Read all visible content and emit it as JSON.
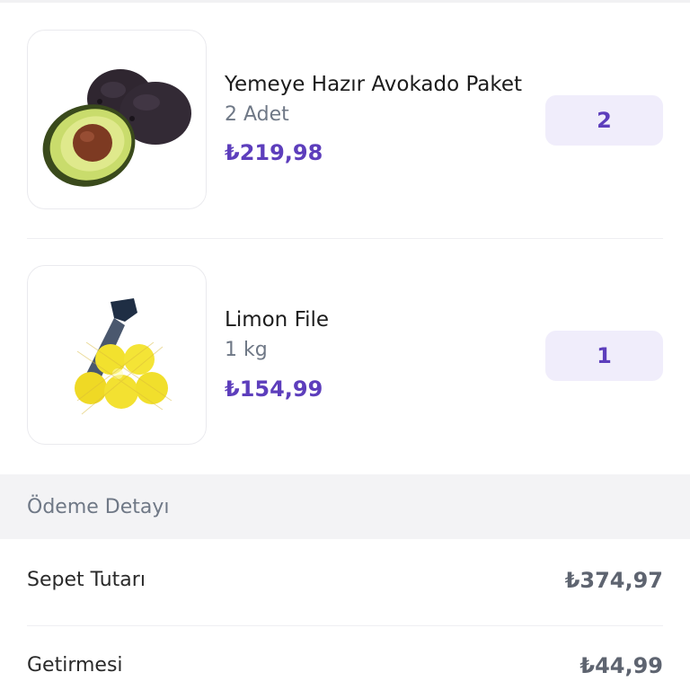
{
  "cart": {
    "items": [
      {
        "name": "Yemeye Hazır Avokado Paket",
        "unit": "2 Adet",
        "price": "₺219,98",
        "quantity": "2",
        "image_icon": "avocado-image"
      },
      {
        "name": "Limon File",
        "unit": "1 kg",
        "price": "₺154,99",
        "quantity": "1",
        "image_icon": "lemon-net-image"
      }
    ]
  },
  "payment": {
    "title": "Ödeme Detayı",
    "rows": [
      {
        "label": "Sepet Tutarı",
        "value": "₺374,97"
      },
      {
        "label": "Getirmesi",
        "value": "₺44,99"
      }
    ]
  },
  "colors": {
    "accent": "#5d3ebc",
    "badge_bg": "#f0edfb",
    "muted_text": "#6f7886",
    "section_bg": "#f3f3f5"
  }
}
